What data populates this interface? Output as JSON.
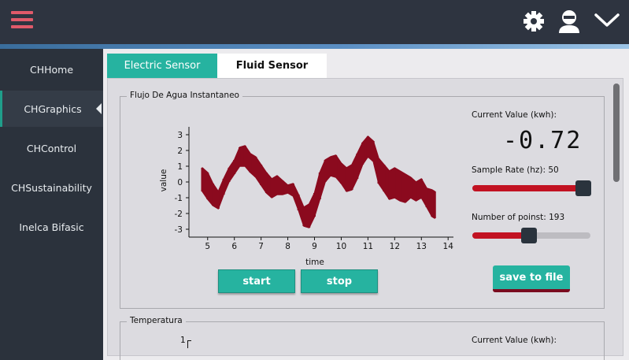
{
  "topbar": {
    "menu_icon": "hamburger-menu-icon",
    "settings_icon": "gear-icon",
    "user_icon": "user-avatar-icon",
    "dropdown_icon": "chevron-down-icon",
    "accent_color": "#e05a6a"
  },
  "sidebar": {
    "items": [
      {
        "label": "CHHome"
      },
      {
        "label": "CHGraphics",
        "active": true
      },
      {
        "label": "CHControl"
      },
      {
        "label": "CHSustainability"
      },
      {
        "label": "Inelca Bifasic"
      }
    ]
  },
  "tabs": [
    {
      "label": "Electric Sensor"
    },
    {
      "label": "Fluid Sensor",
      "active": true
    }
  ],
  "flow_group": {
    "title": "Flujo De Agua Instantaneo",
    "current_value_label": "Current Value (kwh):",
    "current_value": "-0.72",
    "sample_rate_label": "Sample Rate (hz): 50",
    "sample_rate_fraction": 0.94,
    "points_label": "Number of poinst: 193",
    "points_fraction": 0.48,
    "start_label": "start",
    "stop_label": "stop",
    "save_label": "save to file"
  },
  "temp_group": {
    "title": "Temperatura",
    "current_value_label": "Current Value (kwh):",
    "y_tick": "1"
  },
  "colors": {
    "teal": "#26b3a0",
    "line": "#8b0a1e",
    "slider_fill": "#c21222"
  },
  "chart_data": {
    "type": "line",
    "xlabel": "time",
    "ylabel": "value",
    "xlim": [
      4.3,
      14.2
    ],
    "ylim": [
      -3.5,
      3.5
    ],
    "xticks": [
      5,
      6,
      7,
      8,
      9,
      10,
      11,
      12,
      13,
      14
    ],
    "yticks": [
      3,
      2,
      1,
      0,
      -1,
      -2,
      -3
    ],
    "series": [
      {
        "x": [
          4.8,
          5.0,
          5.2,
          5.4,
          5.6,
          5.8,
          6.0,
          6.2,
          6.4,
          6.6,
          6.8,
          7.0,
          7.2,
          7.4,
          7.6,
          7.8,
          8.0,
          8.2,
          8.4,
          8.6,
          8.8,
          9.0,
          9.2,
          9.4,
          9.6,
          9.8,
          10.0,
          10.2,
          10.4,
          10.6,
          10.8,
          11.0,
          11.2,
          11.4,
          11.6,
          11.8,
          12.0,
          12.2,
          12.4,
          12.6,
          12.8,
          13.0,
          13.2,
          13.4,
          13.5
        ],
        "high": [
          0.9,
          0.6,
          -0.1,
          -0.6,
          0.2,
          0.9,
          1.4,
          2.2,
          2.3,
          1.8,
          1.6,
          1.1,
          0.6,
          0.2,
          0.4,
          0.1,
          -0.2,
          -0.1,
          -0.8,
          -1.6,
          -1.4,
          -0.7,
          0.6,
          1.4,
          1.6,
          1.7,
          1.2,
          0.9,
          1.1,
          1.8,
          2.5,
          2.9,
          2.6,
          1.5,
          1.1,
          0.7,
          0.9,
          0.7,
          0.5,
          0.3,
          0.0,
          0.2,
          -0.4,
          -0.5,
          -0.6
        ],
        "low": [
          -0.6,
          -1.1,
          -1.5,
          -1.7,
          -0.8,
          0.0,
          0.5,
          1.0,
          1.0,
          0.6,
          0.3,
          -0.2,
          -0.7,
          -1.0,
          -0.8,
          -0.8,
          -0.7,
          -0.9,
          -1.8,
          -2.8,
          -2.9,
          -2.2,
          -1.1,
          0.0,
          0.4,
          0.3,
          -0.1,
          -0.6,
          -0.5,
          0.2,
          1.1,
          1.6,
          1.3,
          -0.1,
          -0.6,
          -1.1,
          -1.0,
          -1.2,
          -1.3,
          -1.0,
          -1.2,
          -1.0,
          -1.6,
          -2.2,
          -2.3
        ]
      }
    ]
  }
}
